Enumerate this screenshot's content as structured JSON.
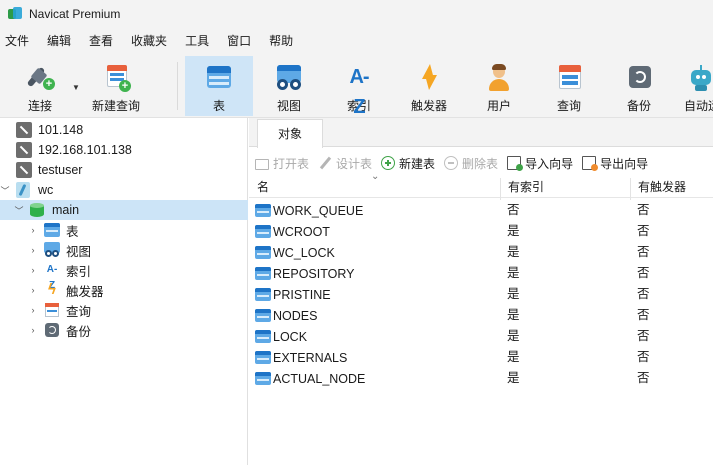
{
  "window": {
    "title": "Navicat Premium"
  },
  "menu": [
    "文件",
    "编辑",
    "查看",
    "收藏夹",
    "工具",
    "窗口",
    "帮助"
  ],
  "toolbar": {
    "connect": "连接",
    "new_query": "新建查询",
    "table": "表",
    "view": "视图",
    "index": "索引",
    "index_icon_text": "A-Z",
    "trigger": "触发器",
    "user": "用户",
    "query": "查询",
    "backup": "备份",
    "automation": "自动运"
  },
  "tree": {
    "connections": [
      "101.148",
      "192.168.101.138",
      "testuser"
    ],
    "database": "wc",
    "schema": "main",
    "children": [
      "表",
      "视图",
      "索引",
      "触发器",
      "查询",
      "备份"
    ],
    "index_icon_text": "A-Z"
  },
  "tabs": {
    "objects": "对象"
  },
  "object_toolbar": {
    "open_table": "打开表",
    "design_table": "设计表",
    "new_table": "新建表",
    "delete_table": "删除表",
    "import_wizard": "导入向导",
    "export_wizard": "导出向导"
  },
  "grid": {
    "columns": [
      "名",
      "有索引",
      "有触发器"
    ],
    "rows": [
      {
        "name": "WORK_QUEUE",
        "has_index": "否",
        "has_trigger": "否"
      },
      {
        "name": "WCROOT",
        "has_index": "是",
        "has_trigger": "否"
      },
      {
        "name": "WC_LOCK",
        "has_index": "是",
        "has_trigger": "否"
      },
      {
        "name": "REPOSITORY",
        "has_index": "是",
        "has_trigger": "否"
      },
      {
        "name": "PRISTINE",
        "has_index": "是",
        "has_trigger": "否"
      },
      {
        "name": "NODES",
        "has_index": "是",
        "has_trigger": "否"
      },
      {
        "name": "LOCK",
        "has_index": "是",
        "has_trigger": "否"
      },
      {
        "name": "EXTERNALS",
        "has_index": "是",
        "has_trigger": "否"
      },
      {
        "name": "ACTUAL_NODE",
        "has_index": "是",
        "has_trigger": "否"
      }
    ]
  },
  "colors": {
    "selected": "#cce4f7",
    "accent": "#1e74c7"
  }
}
